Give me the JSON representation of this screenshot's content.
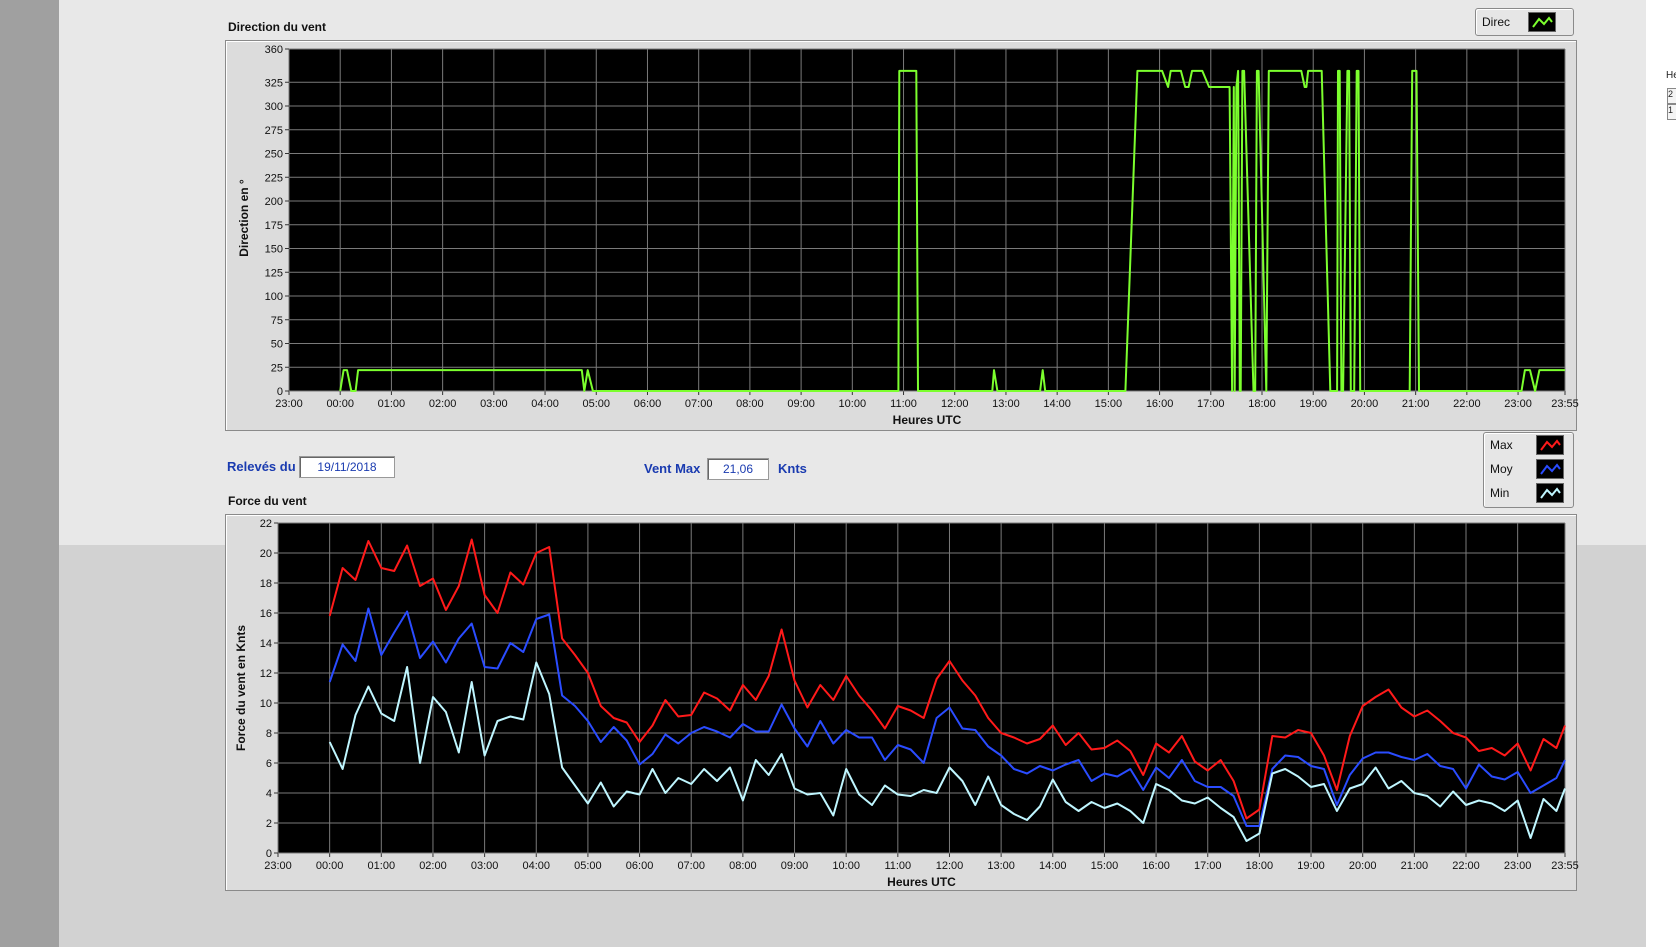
{
  "top_section": {
    "title": "Direction du vent"
  },
  "bottom_section": {
    "title": "Force du vent"
  },
  "releves": {
    "label": "Relevés du",
    "value": "19/11/2018"
  },
  "vent_max": {
    "label": "Vent Max",
    "value": "21,06",
    "unit": "Knts"
  },
  "legend_top": [
    {
      "label": "Direc",
      "color": "#7cff2e"
    }
  ],
  "legend_bottom": [
    {
      "label": "Max",
      "color": "#ff1a1a"
    },
    {
      "label": "Moy",
      "color": "#2a4cff"
    },
    {
      "label": "Min",
      "color": "#bff6ff"
    }
  ],
  "right_strip": {
    "line1": "He",
    "box1": "2",
    "box2": "1"
  },
  "chart_data": [
    {
      "type": "line",
      "title": "",
      "xlabel": "Heures UTC",
      "ylabel": "Direction en °",
      "xlim": [
        -60,
        1435
      ],
      "ylim": [
        0,
        360
      ],
      "x_ticks": [
        {
          "v": -60,
          "l": "23:00"
        },
        {
          "v": 0,
          "l": "00:00"
        },
        {
          "v": 60,
          "l": "01:00"
        },
        {
          "v": 120,
          "l": "02:00"
        },
        {
          "v": 180,
          "l": "03:00"
        },
        {
          "v": 240,
          "l": "04:00"
        },
        {
          "v": 300,
          "l": "05:00"
        },
        {
          "v": 360,
          "l": "06:00"
        },
        {
          "v": 420,
          "l": "07:00"
        },
        {
          "v": 480,
          "l": "08:00"
        },
        {
          "v": 540,
          "l": "09:00"
        },
        {
          "v": 600,
          "l": "10:00"
        },
        {
          "v": 660,
          "l": "11:00"
        },
        {
          "v": 720,
          "l": "12:00"
        },
        {
          "v": 780,
          "l": "13:00"
        },
        {
          "v": 840,
          "l": "14:00"
        },
        {
          "v": 900,
          "l": "15:00"
        },
        {
          "v": 960,
          "l": "16:00"
        },
        {
          "v": 1020,
          "l": "17:00"
        },
        {
          "v": 1080,
          "l": "18:00"
        },
        {
          "v": 1140,
          "l": "19:00"
        },
        {
          "v": 1200,
          "l": "20:00"
        },
        {
          "v": 1260,
          "l": "21:00"
        },
        {
          "v": 1320,
          "l": "22:00"
        },
        {
          "v": 1380,
          "l": "23:00"
        },
        {
          "v": 1435,
          "l": "23:55"
        }
      ],
      "y_ticks": [
        0,
        25,
        50,
        75,
        100,
        125,
        150,
        175,
        200,
        225,
        250,
        275,
        300,
        325,
        360
      ],
      "grid": true,
      "legend": "top-right",
      "series": [
        {
          "name": "Direc",
          "color": "#7cff2e",
          "x": [
            0,
            4,
            8,
            13,
            18,
            21,
            24,
            30,
            280,
            283,
            286,
            290,
            296,
            300,
            350,
            400,
            450,
            500,
            550,
            600,
            620,
            650,
            654,
            655,
            657,
            658,
            659,
            670,
            672,
            675,
            677,
            678,
            680,
            690,
            700,
            710,
            750,
            764,
            766,
            770,
            780,
            800,
            820,
            823,
            826,
            830,
            840,
            860,
            870,
            892,
            895,
            897,
            910,
            920,
            934,
            937,
            940,
            950,
            963,
            970,
            973,
            975,
            985,
            990,
            994,
            998,
            1000,
            1005,
            1007,
            1010,
            1018,
            1033,
            1036,
            1040,
            1042,
            1045,
            1047,
            1048,
            1050,
            1052,
            1054,
            1055,
            1057,
            1059,
            1070,
            1072,
            1074,
            1076,
            1085,
            1088,
            1090,
            1092,
            1120,
            1124,
            1126,
            1130,
            1132,
            1134,
            1150,
            1160,
            1166,
            1168,
            1169,
            1171,
            1173,
            1175,
            1180,
            1182,
            1184,
            1186,
            1188,
            1191,
            1193,
            1195,
            1200,
            1220,
            1250,
            1253,
            1256,
            1258,
            1261,
            1264,
            1270,
            1300,
            1350,
            1384,
            1388,
            1394,
            1400,
            1405,
            1435
          ],
          "y": [
            0,
            22,
            22,
            0,
            0,
            22,
            22,
            22,
            22,
            22,
            0,
            22,
            0,
            0,
            0,
            0,
            0,
            0,
            0,
            0,
            0,
            0,
            0,
            337,
            337,
            337,
            337,
            337,
            337,
            337,
            0,
            0,
            0,
            0,
            0,
            0,
            0,
            0,
            22,
            0,
            0,
            0,
            0,
            22,
            0,
            0,
            0,
            0,
            0,
            0,
            0,
            0,
            0,
            0,
            337,
            337,
            337,
            337,
            337,
            320,
            337,
            337,
            337,
            320,
            320,
            337,
            337,
            337,
            337,
            337,
            320,
            320,
            320,
            320,
            320,
            0,
            320,
            0,
            320,
            337,
            0,
            0,
            337,
            337,
            0,
            0,
            337,
            337,
            0,
            337,
            337,
            337,
            337,
            337,
            337,
            320,
            320,
            337,
            337,
            0,
            0,
            0,
            337,
            337,
            0,
            0,
            337,
            337,
            0,
            0,
            0,
            337,
            337,
            0,
            0,
            0,
            0,
            0,
            337,
            337,
            337,
            0,
            0,
            0,
            0,
            0,
            22,
            22,
            0,
            22,
            22
          ]
        }
      ]
    },
    {
      "type": "line",
      "title": "",
      "xlabel": "Heures UTC",
      "ylabel": "Force du vent en Knts",
      "xlim": [
        -60,
        1435
      ],
      "ylim": [
        0,
        22
      ],
      "x_ticks": [
        {
          "v": -60,
          "l": "23:00"
        },
        {
          "v": 0,
          "l": "00:00"
        },
        {
          "v": 60,
          "l": "01:00"
        },
        {
          "v": 120,
          "l": "02:00"
        },
        {
          "v": 180,
          "l": "03:00"
        },
        {
          "v": 240,
          "l": "04:00"
        },
        {
          "v": 300,
          "l": "05:00"
        },
        {
          "v": 360,
          "l": "06:00"
        },
        {
          "v": 420,
          "l": "07:00"
        },
        {
          "v": 480,
          "l": "08:00"
        },
        {
          "v": 540,
          "l": "09:00"
        },
        {
          "v": 600,
          "l": "10:00"
        },
        {
          "v": 660,
          "l": "11:00"
        },
        {
          "v": 720,
          "l": "12:00"
        },
        {
          "v": 780,
          "l": "13:00"
        },
        {
          "v": 840,
          "l": "14:00"
        },
        {
          "v": 900,
          "l": "15:00"
        },
        {
          "v": 960,
          "l": "16:00"
        },
        {
          "v": 1020,
          "l": "17:00"
        },
        {
          "v": 1080,
          "l": "18:00"
        },
        {
          "v": 1140,
          "l": "19:00"
        },
        {
          "v": 1200,
          "l": "20:00"
        },
        {
          "v": 1260,
          "l": "21:00"
        },
        {
          "v": 1320,
          "l": "22:00"
        },
        {
          "v": 1380,
          "l": "23:00"
        },
        {
          "v": 1435,
          "l": "23:55"
        }
      ],
      "y_ticks": [
        0,
        2,
        4,
        6,
        8,
        10,
        12,
        14,
        16,
        18,
        20,
        22
      ],
      "grid": true,
      "legend": "top-right",
      "x": [
        0,
        15,
        30,
        45,
        60,
        75,
        90,
        105,
        120,
        135,
        150,
        165,
        180,
        195,
        210,
        225,
        240,
        255,
        270,
        285,
        300,
        315,
        330,
        345,
        360,
        375,
        390,
        405,
        420,
        435,
        450,
        465,
        480,
        495,
        510,
        525,
        540,
        555,
        570,
        585,
        600,
        615,
        630,
        645,
        660,
        675,
        690,
        705,
        720,
        735,
        750,
        765,
        780,
        795,
        810,
        825,
        840,
        855,
        870,
        885,
        900,
        915,
        930,
        945,
        960,
        975,
        990,
        1005,
        1020,
        1035,
        1050,
        1065,
        1080,
        1095,
        1110,
        1125,
        1140,
        1155,
        1170,
        1185,
        1200,
        1215,
        1230,
        1245,
        1260,
        1275,
        1290,
        1305,
        1320,
        1335,
        1350,
        1365,
        1380,
        1395,
        1410,
        1425,
        1435
      ],
      "series": [
        {
          "name": "Max",
          "color": "#ff1a1a",
          "values": [
            15.8,
            19.0,
            18.2,
            20.8,
            19.0,
            18.8,
            20.5,
            17.8,
            18.3,
            16.2,
            17.8,
            20.9,
            17.2,
            16.0,
            18.7,
            17.9,
            20.0,
            20.4,
            14.3,
            13.2,
            12.0,
            9.8,
            9.0,
            8.7,
            7.4,
            8.5,
            10.2,
            9.1,
            9.2,
            10.7,
            10.3,
            9.5,
            11.2,
            10.2,
            11.8,
            14.9,
            11.5,
            9.7,
            11.2,
            10.2,
            11.8,
            10.5,
            9.5,
            8.3,
            9.8,
            9.5,
            9.0,
            11.6,
            12.8,
            11.5,
            10.5,
            9.0,
            8.0,
            7.7,
            7.3,
            7.6,
            8.5,
            7.2,
            8.0,
            6.9,
            7.0,
            7.5,
            6.8,
            5.2,
            7.3,
            6.7,
            7.8,
            6.1,
            5.5,
            6.2,
            4.8,
            2.3,
            2.9,
            7.8,
            7.7,
            8.2,
            8.0,
            6.5,
            4.2,
            7.8,
            9.8,
            10.4,
            10.9,
            9.7,
            9.1,
            9.5,
            8.8,
            8.0,
            7.7,
            6.8,
            7.0,
            6.5,
            7.3,
            5.5,
            7.6,
            7.0,
            8.5
          ]
        },
        {
          "name": "Moy",
          "color": "#2a4cff",
          "values": [
            11.4,
            13.9,
            12.8,
            16.3,
            13.2,
            14.7,
            16.1,
            13.0,
            14.1,
            12.7,
            14.3,
            15.3,
            12.4,
            12.3,
            14.0,
            13.4,
            15.6,
            15.9,
            10.5,
            9.8,
            8.8,
            7.4,
            8.4,
            7.5,
            5.9,
            6.6,
            7.9,
            7.3,
            8.0,
            8.4,
            8.1,
            7.7,
            8.6,
            8.1,
            8.1,
            9.9,
            8.3,
            7.1,
            8.8,
            7.3,
            8.2,
            7.7,
            7.7,
            6.2,
            7.2,
            6.9,
            6.0,
            9.0,
            9.7,
            8.3,
            8.2,
            7.1,
            6.5,
            5.6,
            5.3,
            5.8,
            5.5,
            5.9,
            6.2,
            4.8,
            5.3,
            5.1,
            5.6,
            4.2,
            5.7,
            5.0,
            6.2,
            4.8,
            4.4,
            4.4,
            3.8,
            1.8,
            1.8,
            5.6,
            6.5,
            6.4,
            5.8,
            5.6,
            3.2,
            5.2,
            6.3,
            6.7,
            6.7,
            6.4,
            6.2,
            6.6,
            5.8,
            5.6,
            4.3,
            5.9,
            5.1,
            4.9,
            5.4,
            4.0,
            4.5,
            5.0,
            6.2
          ]
        },
        {
          "name": "Min",
          "color": "#bff6ff",
          "values": [
            7.4,
            5.6,
            9.2,
            11.1,
            9.3,
            8.8,
            12.4,
            6.0,
            10.4,
            9.4,
            6.7,
            11.4,
            6.5,
            8.8,
            9.1,
            8.9,
            12.7,
            10.6,
            5.7,
            4.5,
            3.3,
            4.7,
            3.1,
            4.1,
            3.9,
            5.6,
            4.0,
            5.0,
            4.6,
            5.6,
            4.8,
            5.7,
            3.5,
            6.2,
            5.2,
            6.6,
            4.3,
            3.9,
            4.0,
            2.5,
            5.6,
            3.9,
            3.2,
            4.5,
            3.9,
            3.8,
            4.2,
            4.0,
            5.7,
            4.8,
            3.2,
            5.1,
            3.2,
            2.6,
            2.2,
            3.1,
            4.9,
            3.4,
            2.8,
            3.4,
            3.0,
            3.3,
            2.8,
            2.0,
            4.6,
            4.2,
            3.5,
            3.3,
            3.7,
            3.0,
            2.4,
            0.8,
            1.3,
            5.3,
            5.6,
            5.1,
            4.4,
            4.6,
            2.8,
            4.3,
            4.6,
            5.7,
            4.3,
            4.8,
            4.0,
            3.8,
            3.1,
            4.1,
            3.2,
            3.5,
            3.3,
            2.8,
            3.5,
            1.0,
            3.6,
            2.8,
            4.3
          ]
        }
      ]
    }
  ]
}
